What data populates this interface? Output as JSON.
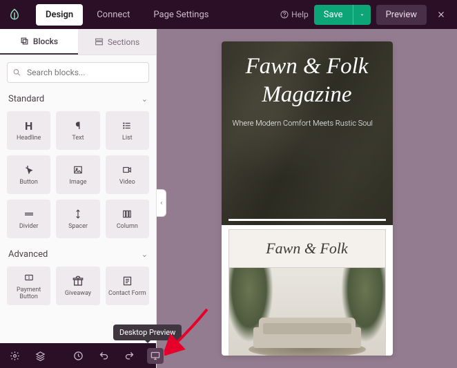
{
  "topbar": {
    "nav": {
      "design": "Design",
      "connect": "Connect",
      "page_settings": "Page Settings"
    },
    "help": "Help",
    "save": "Save",
    "preview": "Preview"
  },
  "sidebar": {
    "tabs": {
      "blocks": "Blocks",
      "sections": "Sections"
    },
    "search_placeholder": "Search blocks...",
    "standard": {
      "title": "Standard",
      "items": {
        "headline": "Headline",
        "text": "Text",
        "list": "List",
        "button": "Button",
        "image": "Image",
        "video": "Video",
        "divider": "Divider",
        "spacer": "Spacer",
        "column": "Column"
      }
    },
    "advanced": {
      "title": "Advanced",
      "items": {
        "payment_button": "Payment\nButton",
        "giveaway": "Giveaway",
        "contact_form": "Contact Form"
      }
    }
  },
  "tooltip": "Desktop Preview",
  "canvas": {
    "hero_title": "Fawn & Folk Magazine",
    "hero_sub": "Where Modern Comfort Meets Rustic Soul",
    "card_title": "Fawn & Folk"
  },
  "colors": {
    "accent": "#0da577",
    "top": "#2a0f27",
    "bg": "#947c90"
  }
}
